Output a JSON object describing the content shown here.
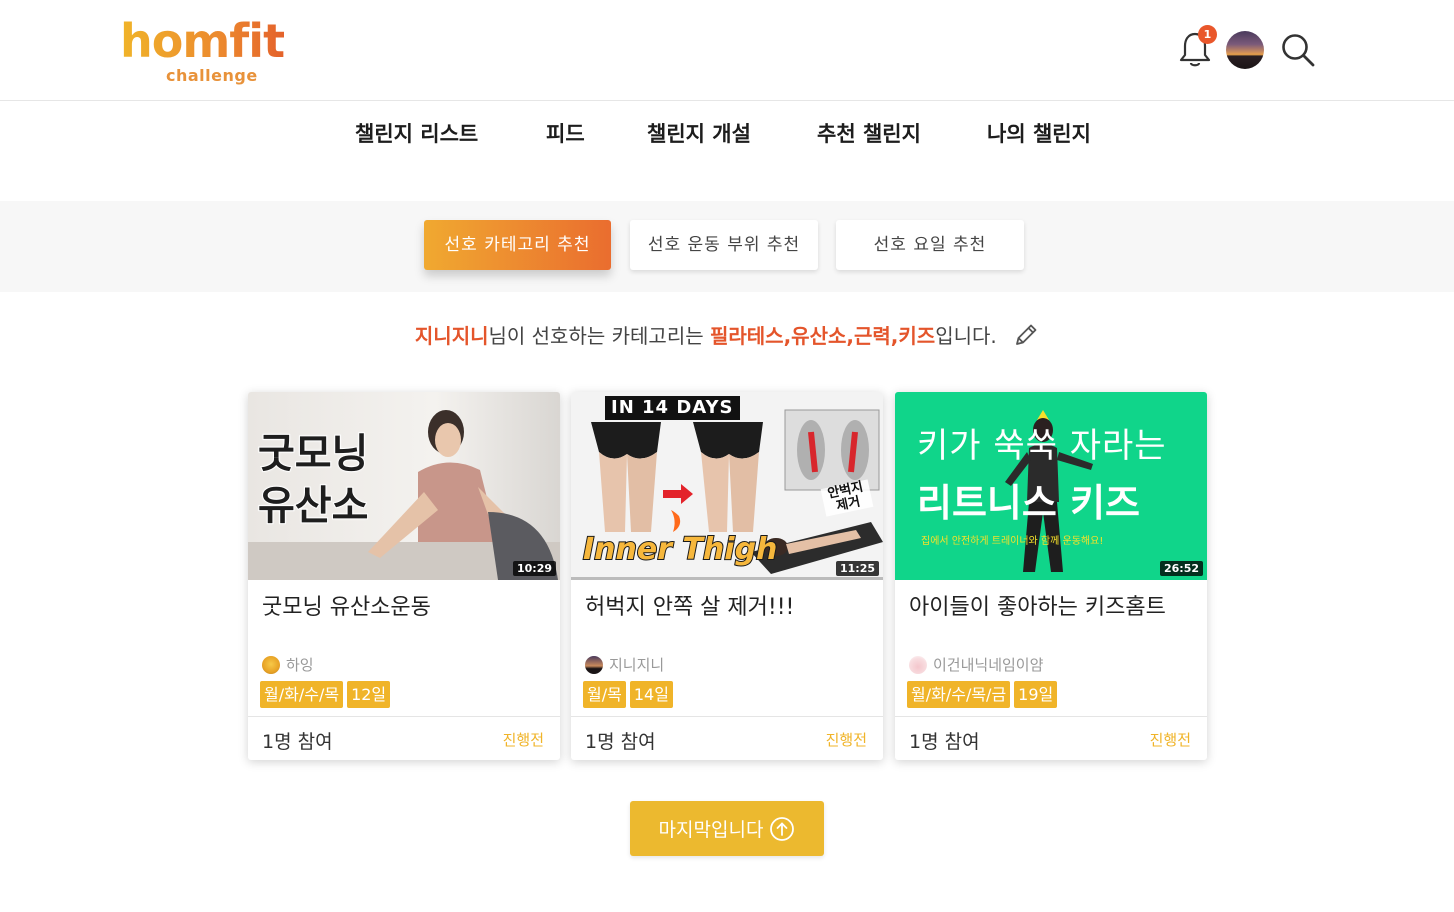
{
  "brand": {
    "name": "homfit",
    "sub": "challenge"
  },
  "header": {
    "notification_count": "1"
  },
  "nav": {
    "items": [
      "챌린지 리스트",
      "피드",
      "챌린지 개설",
      "추천 챌린지",
      "나의 챌린지"
    ]
  },
  "tabs": {
    "category": "선호 카테고리 추천",
    "body_part": "선호 운동 부위 추천",
    "weekday": "선호 요일 추천"
  },
  "preference": {
    "user": "지니지니",
    "text_mid": "님이 선호하는 카테고리는 ",
    "categories": "필라테스,유산소,근력,키즈",
    "text_end": "입니다."
  },
  "cards": [
    {
      "thumb_text": [
        "굿모닝",
        "유산소"
      ],
      "duration": "10:29",
      "title": "굿모닝 유산소운동",
      "author": "하잉",
      "days": "월/화/수/목",
      "period": "12일",
      "participants": "1명 참여",
      "status": "진행전"
    },
    {
      "thumb_text": [
        "IN 14 DAYS",
        "Inner Thigh",
        "안벅지 제거"
      ],
      "duration": "11:25",
      "title": "허벅지 안쪽 살 제거!!!",
      "author": "지니지니",
      "days": "월/목",
      "period": "14일",
      "participants": "1명 참여",
      "status": "진행전"
    },
    {
      "thumb_text": [
        "키가 쑥쑥 자라는",
        "리트니스 키즈",
        "집에서 안전하게 트레이너와 함께 운동해요!"
      ],
      "duration": "26:52",
      "title": "아이들이 좋아하는 키즈홈트",
      "author": "이건내닉네임이얌",
      "days": "월/화/수/목/금",
      "period": "19일",
      "participants": "1명 참여",
      "status": "진행전"
    }
  ],
  "footer": {
    "last_label": "마지막입니다"
  },
  "colors": {
    "accent": "#f0b429",
    "highlight": "#e4552b",
    "tab_gradient_end": "#ea6d2f"
  }
}
